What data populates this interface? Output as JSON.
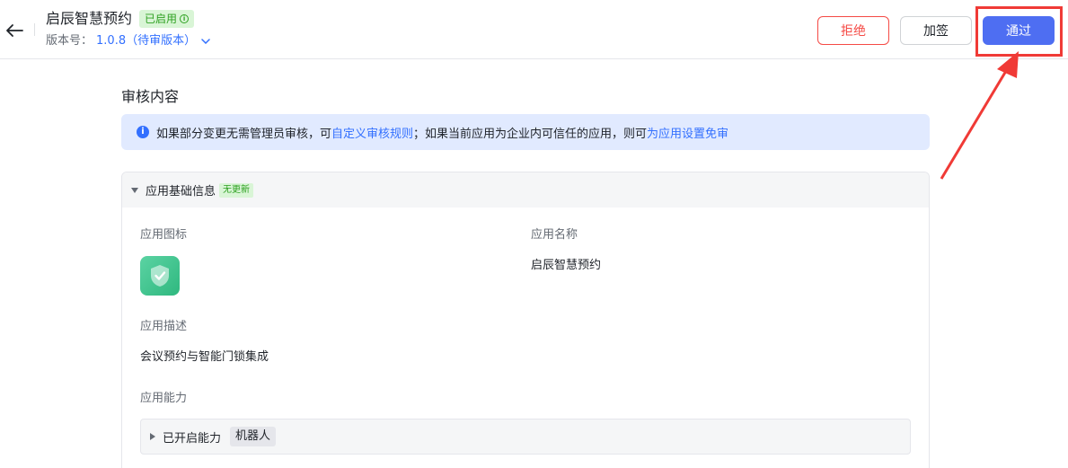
{
  "header": {
    "app_name": "启辰智慧预约",
    "status_badge": "已启用",
    "version_label": "版本号：",
    "version_value": "1.0.8（待审版本）",
    "reject_label": "拒绝",
    "cosign_label": "加签",
    "approve_label": "通过"
  },
  "main": {
    "section_title": "审核内容",
    "notice": {
      "text_1": "如果部分变更无需管理员审核，可",
      "link_1": "自定义审核规则",
      "text_2": "；如果当前应用为企业内可信任的应用，则可",
      "link_2": "为应用设置免审"
    },
    "card": {
      "title": "应用基础信息",
      "tag": "无更新",
      "icon_label": "应用图标",
      "name_label": "应用名称",
      "name_value": "启辰智慧预约",
      "desc_label": "应用描述",
      "desc_value": "会议预约与智能门锁集成",
      "ability_label": "应用能力",
      "ability_enabled": "已开启能力",
      "ability_tag": "机器人"
    }
  },
  "colors": {
    "primary": "#4e6ef2",
    "danger": "#f54a45",
    "success": "#2ea121",
    "link": "#3370ff",
    "annotation": "#f03a36"
  },
  "icons": [
    "back-arrow-icon",
    "info-icon",
    "chevron-down-icon",
    "caret-down-icon",
    "caret-right-icon",
    "shield-check-icon"
  ]
}
